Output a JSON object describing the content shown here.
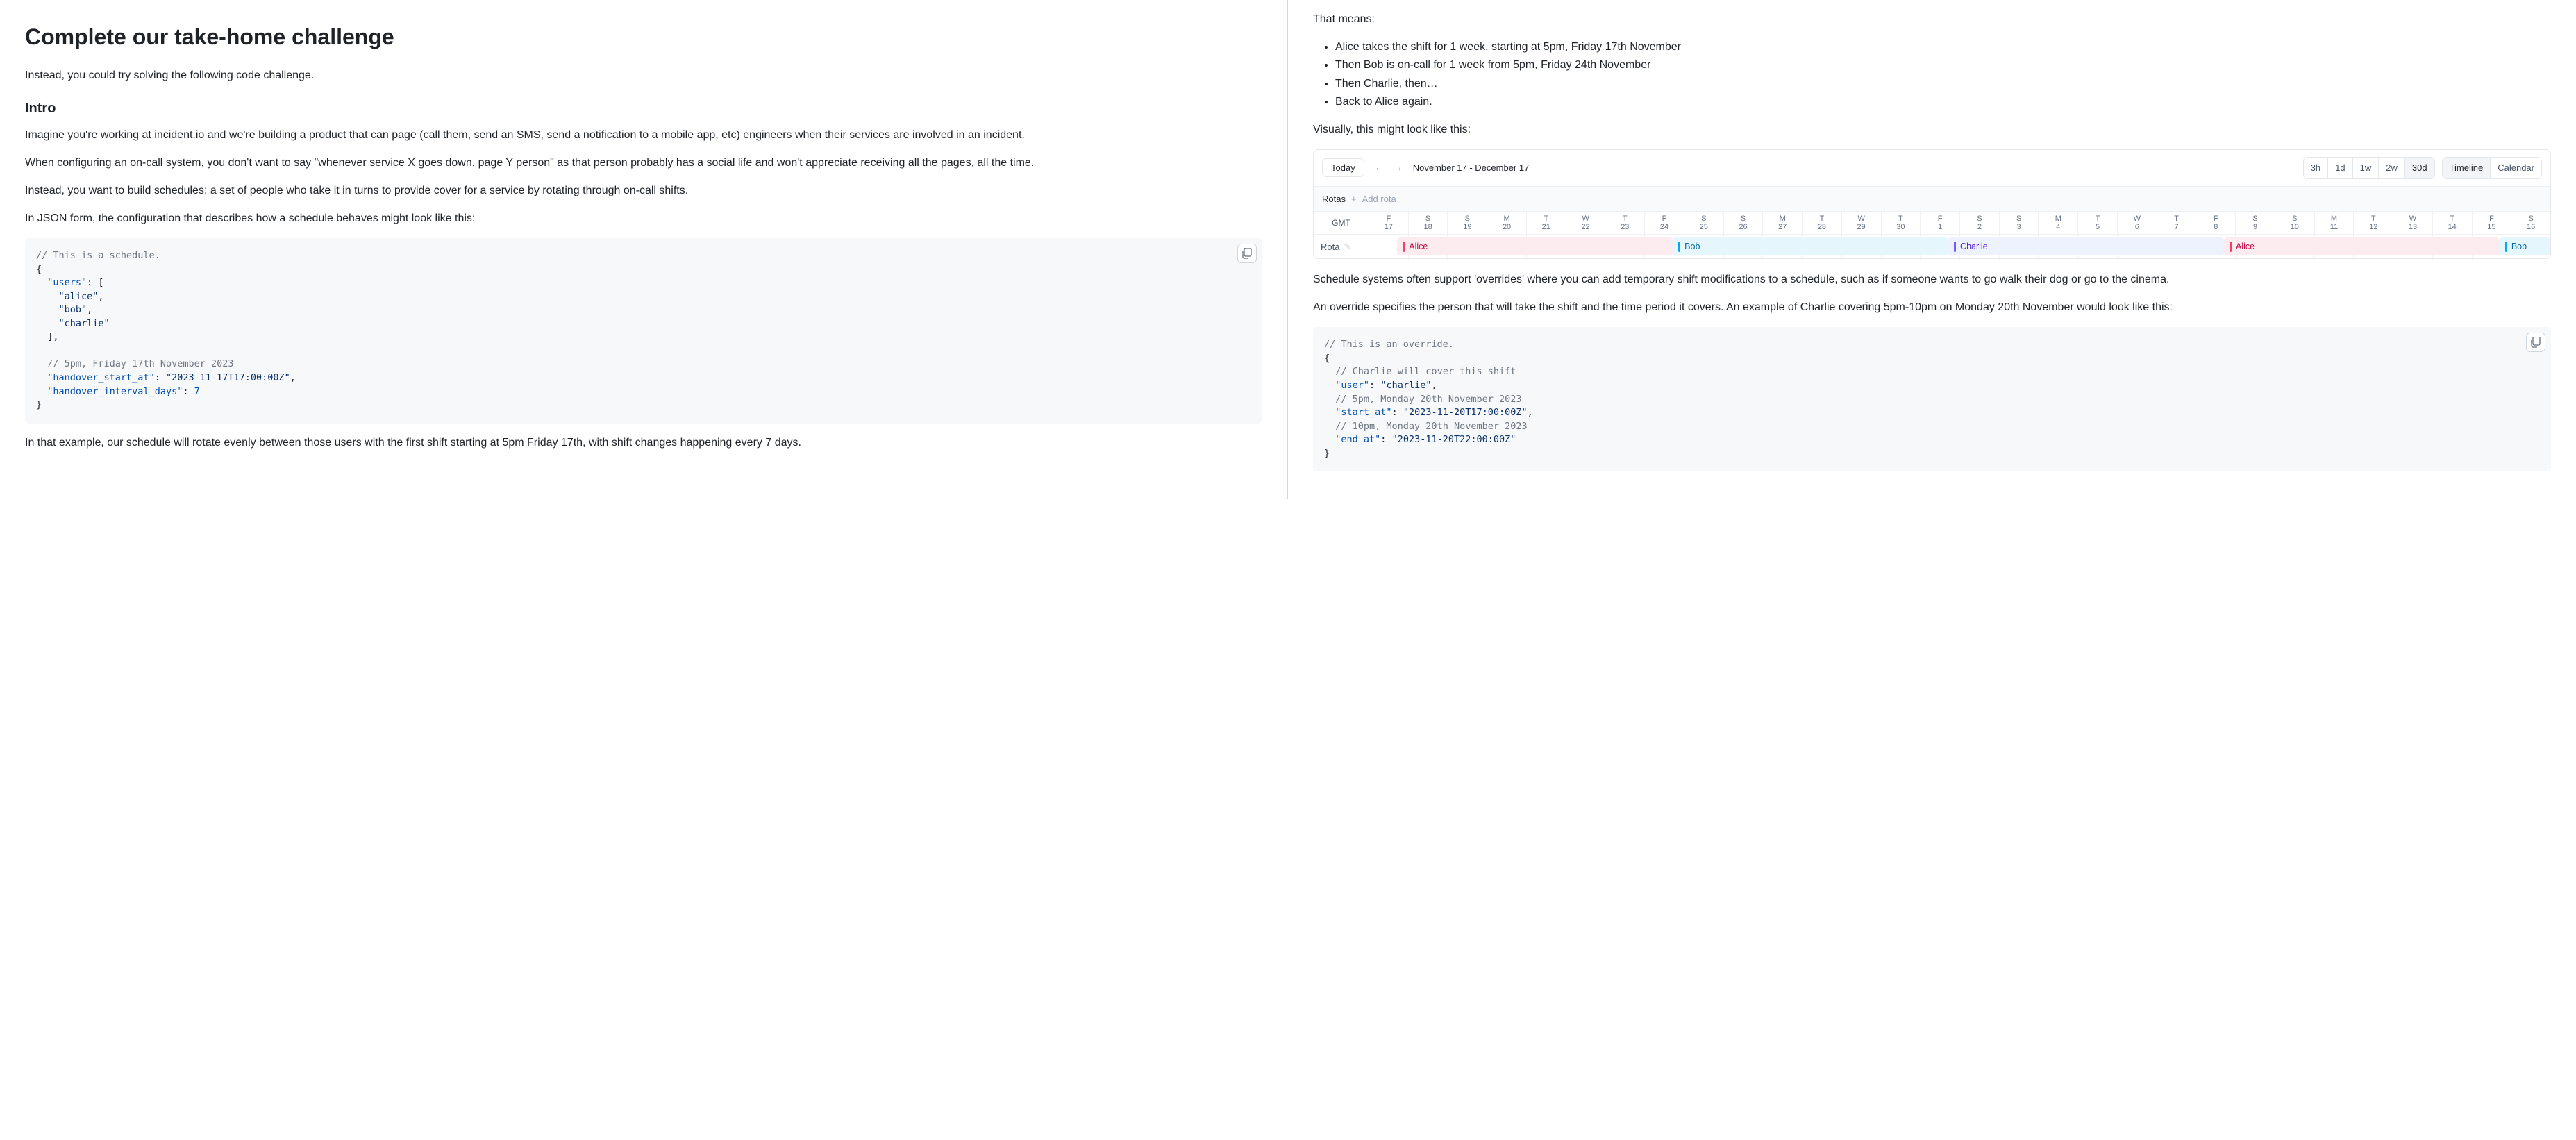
{
  "left": {
    "title": "Complete our take-home challenge",
    "p_intro": "Instead, you could try solving the following code challenge.",
    "h_intro": "Intro",
    "p_imagine": "Imagine you're working at incident.io and we're building a product that can page (call them, send an SMS, send a notification to a mobile app, etc) engineers when their services are involved in an incident.",
    "p_config": "When configuring an on-call system, you don't want to say \"whenever service X goes down, page Y person\" as that person probably has a social life and won't appreciate receiving all the pages, all the time.",
    "p_schedules": "Instead, you want to build schedules: a set of people who take it in turns to provide cover for a service by rotating through on-call shifts.",
    "p_json_lead": "In JSON form, the configuration that describes how a schedule behaves might look like this:",
    "code_schedule": {
      "c_schedule": "// This is a schedule.",
      "brace_open": "{",
      "k_users": "\"users\"",
      "arr_open": ": [",
      "s_alice": "\"alice\"",
      "s_bob": "\"bob\"",
      "s_charlie": "\"charlie\"",
      "arr_close": "  ],",
      "c_5pm": "// 5pm, Friday 17th November 2023",
      "k_start": "\"handover_start_at\"",
      "s_start_val": "\"2023-11-17T17:00:00Z\"",
      "k_interval": "\"handover_interval_days\"",
      "n_interval_val": "7",
      "brace_close": "}"
    },
    "p_example_end": "In that example, our schedule will rotate evenly between those users with the first shift starting at 5pm Friday 17th, with shift changes happening every 7 days."
  },
  "right": {
    "p_that_means": "That means:",
    "bullets": {
      "b0": "Alice takes the shift for 1 week, starting at 5pm, Friday 17th November",
      "b1": "Then Bob is on-call for 1 week from 5pm, Friday 24th November",
      "b2": "Then Charlie, then…",
      "b3": "Back to Alice again."
    },
    "p_visually": "Visually, this might look like this:",
    "calendar": {
      "today": "Today",
      "range": "November 17 - December 17",
      "periods": {
        "h3": "3h",
        "d1": "1d",
        "w1": "1w",
        "w2": "2w",
        "d30": "30d"
      },
      "views": {
        "timeline": "Timeline",
        "calendar": "Calendar"
      },
      "rotas_label": "Rotas",
      "add_rota": "Add rota",
      "tz": "GMT",
      "row_label": "Rota",
      "daysDow": [
        "F",
        "S",
        "S",
        "M",
        "T",
        "W",
        "T",
        "F",
        "S",
        "S",
        "M",
        "T",
        "W",
        "T",
        "F",
        "S",
        "S",
        "M",
        "T",
        "W",
        "T",
        "F",
        "S",
        "S",
        "M",
        "T",
        "W",
        "T",
        "F",
        "S"
      ],
      "daysNum": [
        "17",
        "18",
        "19",
        "20",
        "21",
        "22",
        "23",
        "24",
        "25",
        "26",
        "27",
        "28",
        "29",
        "30",
        "1",
        "2",
        "3",
        "4",
        "5",
        "6",
        "7",
        "8",
        "9",
        "10",
        "11",
        "12",
        "13",
        "14",
        "15",
        "16"
      ],
      "shifts": [
        {
          "label": "Alice",
          "cls": "alice",
          "start": 0.71,
          "span": 7
        },
        {
          "label": "Bob",
          "cls": "bob",
          "start": 7.71,
          "span": 7
        },
        {
          "label": "Charlie",
          "cls": "charlie",
          "start": 14.71,
          "span": 7
        },
        {
          "label": "Alice",
          "cls": "alice",
          "start": 21.71,
          "span": 7
        },
        {
          "label": "Bob",
          "cls": "bob",
          "start": 28.71,
          "span": 1.29
        }
      ],
      "totalDays": 30
    },
    "p_overrides": "Schedule systems often support 'overrides' where you can add temporary shift modifications to a schedule, such as if someone wants to go walk their dog or go to the cinema.",
    "p_override_spec": "An override specifies the person that will take the shift and the time period it covers. An example of Charlie covering 5pm-10pm on Monday 20th November would look like this:",
    "code_override": {
      "c_override": "// This is an override.",
      "brace_open": "{",
      "c_cover": "// Charlie will cover this shift",
      "k_user": "\"user\"",
      "s_user_val": "\"charlie\"",
      "c_start": "// 5pm, Monday 20th November 2023",
      "k_start": "\"start_at\"",
      "s_start_val": "\"2023-11-20T17:00:00Z\"",
      "c_end": "// 10pm, Monday 20th November 2023",
      "k_end": "\"end_at\"",
      "s_end_val": "\"2023-11-20T22:00:00Z\"",
      "brace_close": "}"
    }
  }
}
